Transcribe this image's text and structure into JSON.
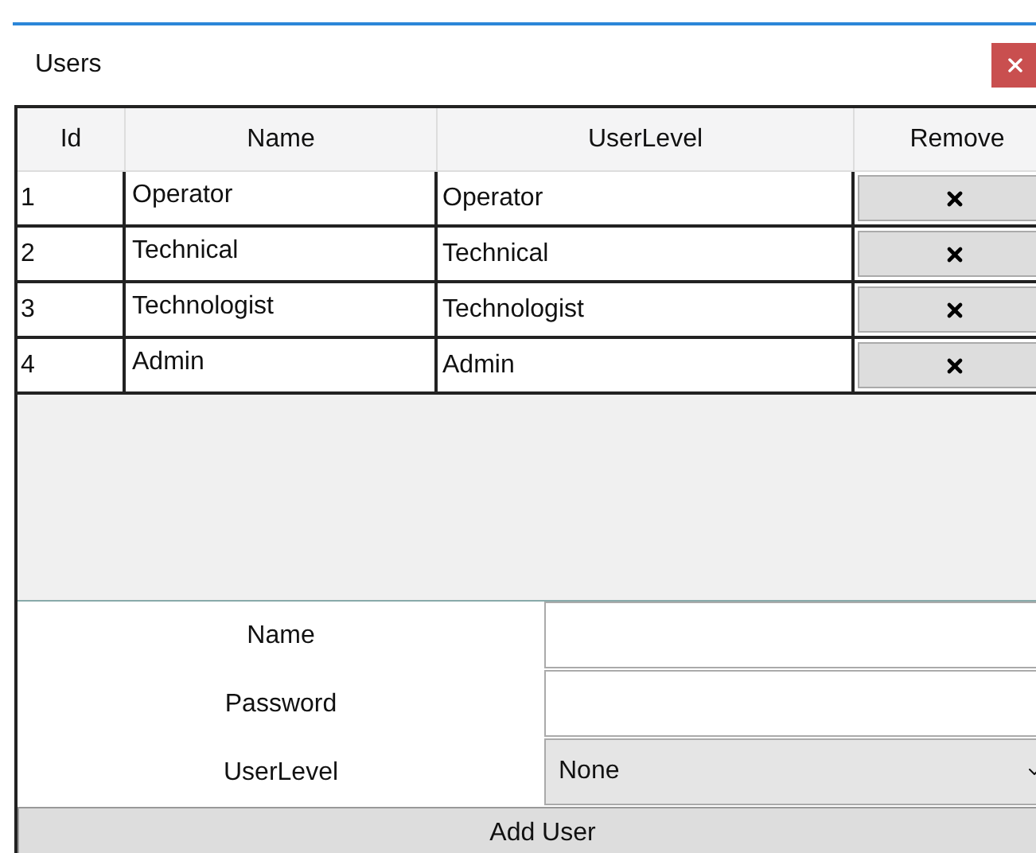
{
  "window": {
    "title": "Users"
  },
  "table": {
    "columns": [
      "Id",
      "Name",
      "UserLevel",
      "Remove"
    ],
    "rows": [
      {
        "id": "1",
        "name": "Operator",
        "level": "Operator"
      },
      {
        "id": "2",
        "name": "Technical",
        "level": "Technical"
      },
      {
        "id": "3",
        "name": "Technologist",
        "level": "Technologist"
      },
      {
        "id": "4",
        "name": "Admin",
        "level": "Admin"
      }
    ]
  },
  "form": {
    "fields": [
      {
        "label": "Name",
        "kind": "text"
      },
      {
        "label": "Password",
        "kind": "password"
      },
      {
        "label": "UserLevel",
        "kind": "select",
        "value": "None"
      }
    ],
    "submit": "Add User"
  }
}
